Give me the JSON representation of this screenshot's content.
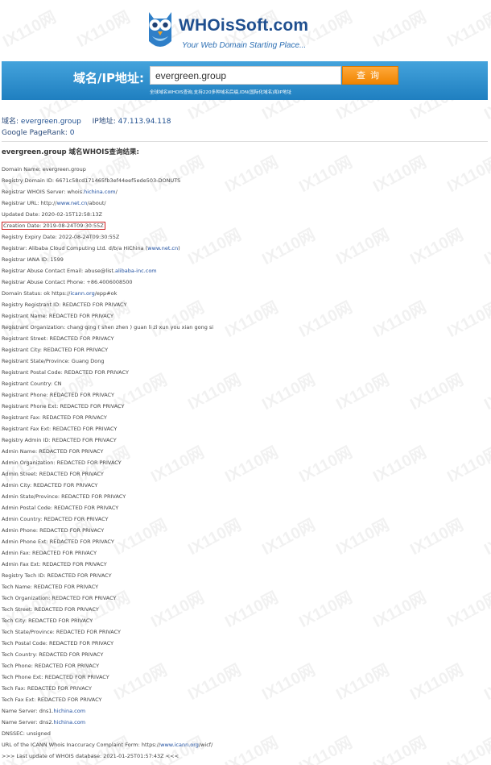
{
  "header": {
    "logo_text": "WHOisSoft.com",
    "tagline": "Your Web Domain Starting Place..."
  },
  "search": {
    "label": "域名/IP地址:",
    "value": "evergreen.group",
    "button": "查询",
    "note": "全球域名WHOIS查询,支持220多种域名后缀,IDN(国际化域名)和IP地址"
  },
  "summary": {
    "domain_label": "域名:",
    "domain_value": "evergreen.group",
    "ip_label": "IP地址:",
    "ip_value": "47.113.94.118",
    "pagerank_label": "Google PageRank:",
    "pagerank_value": "0"
  },
  "result_title": "evergreen.group 域名WHOIS查询结果:",
  "records": [
    {
      "text": "Domain Name: evergreen.group"
    },
    {
      "text": "Registry Domain ID: 6671c58cd171465fb3ef44eef5ede503-DONUTS"
    },
    {
      "text": "Registrar WHOIS Server: whois.",
      "link": "hichina.com",
      "tail": "/"
    },
    {
      "text": "Registrar URL: http://",
      "link": "www.net.cn",
      "tail": "/about/"
    },
    {
      "text": "Updated Date: 2020-02-15T12:58:13Z"
    },
    {
      "text": "Creation Date: 2019-08-24T09:30:55Z",
      "highlight": true
    },
    {
      "text": "Registry Expiry Date: 2022-08-24T09:30:55Z"
    },
    {
      "text": "Registrar: Alibaba Cloud Computing Ltd. d/b/a HiChina (",
      "link": "www.net.cn",
      "tail": ")"
    },
    {
      "text": "Registrar IANA ID: 1599"
    },
    {
      "text": "Registrar Abuse Contact Email: abuse@list.",
      "link": "alibaba-inc.com",
      "tail": ""
    },
    {
      "text": "Registrar Abuse Contact Phone: +86.4006008500"
    },
    {
      "text": "Domain Status: ok https://",
      "link": "icann.org",
      "tail": "/epp#ok"
    },
    {
      "text": "Registry Registrant ID: REDACTED FOR PRIVACY"
    },
    {
      "text": "Registrant Name: REDACTED FOR PRIVACY"
    },
    {
      "text": "Registrant Organization: chang qing ( shen zhen ) guan li zi xun you xian gong si"
    },
    {
      "text": "Registrant Street: REDACTED FOR PRIVACY"
    },
    {
      "text": "Registrant City: REDACTED FOR PRIVACY"
    },
    {
      "text": "Registrant State/Province: Guang Dong"
    },
    {
      "text": "Registrant Postal Code: REDACTED FOR PRIVACY"
    },
    {
      "text": "Registrant Country: CN"
    },
    {
      "text": "Registrant Phone: REDACTED FOR PRIVACY"
    },
    {
      "text": "Registrant Phone Ext: REDACTED FOR PRIVACY"
    },
    {
      "text": "Registrant Fax: REDACTED FOR PRIVACY"
    },
    {
      "text": "Registrant Fax Ext: REDACTED FOR PRIVACY"
    },
    {
      "text": "Registry Admin ID: REDACTED FOR PRIVACY"
    },
    {
      "text": "Admin Name: REDACTED FOR PRIVACY"
    },
    {
      "text": "Admin Organization: REDACTED FOR PRIVACY"
    },
    {
      "text": "Admin Street: REDACTED FOR PRIVACY"
    },
    {
      "text": "Admin City: REDACTED FOR PRIVACY"
    },
    {
      "text": "Admin State/Province: REDACTED FOR PRIVACY"
    },
    {
      "text": "Admin Postal Code: REDACTED FOR PRIVACY"
    },
    {
      "text": "Admin Country: REDACTED FOR PRIVACY"
    },
    {
      "text": "Admin Phone: REDACTED FOR PRIVACY"
    },
    {
      "text": "Admin Phone Ext: REDACTED FOR PRIVACY"
    },
    {
      "text": "Admin Fax: REDACTED FOR PRIVACY"
    },
    {
      "text": "Admin Fax Ext: REDACTED FOR PRIVACY"
    },
    {
      "text": "Registry Tech ID: REDACTED FOR PRIVACY"
    },
    {
      "text": "Tech Name: REDACTED FOR PRIVACY"
    },
    {
      "text": "Tech Organization: REDACTED FOR PRIVACY"
    },
    {
      "text": "Tech Street: REDACTED FOR PRIVACY"
    },
    {
      "text": "Tech City: REDACTED FOR PRIVACY"
    },
    {
      "text": "Tech State/Province: REDACTED FOR PRIVACY"
    },
    {
      "text": "Tech Postal Code: REDACTED FOR PRIVACY"
    },
    {
      "text": "Tech Country: REDACTED FOR PRIVACY"
    },
    {
      "text": "Tech Phone: REDACTED FOR PRIVACY"
    },
    {
      "text": "Tech Phone Ext: REDACTED FOR PRIVACY"
    },
    {
      "text": "Tech Fax: REDACTED FOR PRIVACY"
    },
    {
      "text": "Tech Fax Ext: REDACTED FOR PRIVACY"
    },
    {
      "text": "Name Server: dns1.",
      "link": "hichina.com",
      "tail": ""
    },
    {
      "text": "Name Server: dns2.",
      "link": "hichina.com",
      "tail": ""
    },
    {
      "text": "DNSSEC: unsigned"
    },
    {
      "text": "URL of the ICANN Whois Inaccuracy Complaint Form: https://",
      "link": "www.icann.org",
      "tail": "/wicf/"
    },
    {
      "text": ">>> Last update of WHOIS database: 2021-01-25T01:57:43Z <<<"
    }
  ],
  "watermark_text": "IX110网",
  "colors": {
    "band": "#2b8fd0",
    "button": "#f08400",
    "link": "#1f4fa0",
    "highlight_border": "#cc2222"
  }
}
